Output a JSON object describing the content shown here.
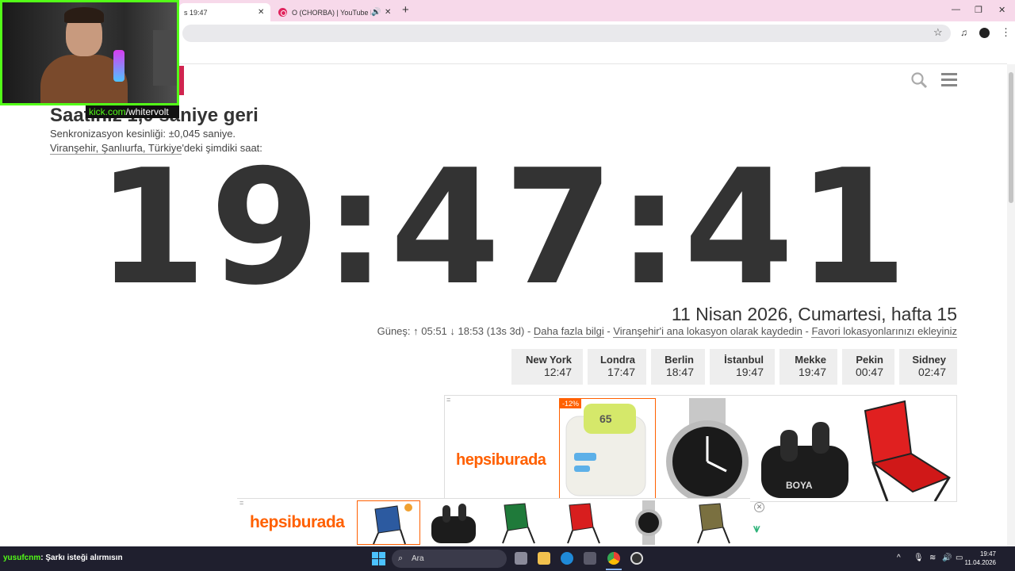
{
  "browser": {
    "tab1_title": "s 19:47",
    "tab2_title": "O (CHORBA) | YouTube Mu",
    "new_tab": "+",
    "close": "✕"
  },
  "overlay": {
    "kick_prefix": "kick.com",
    "kick_channel": "/whitervolt"
  },
  "page": {
    "sync_title": "Saatiniz 1,0 saniye geri",
    "sync_precision": "Senkronizasyon kesinliği: ±0,045 saniye.",
    "location_link": "Viranşehir, Şanlıurfa, Türkiye",
    "location_suffix": "'deki şimdiki saat:",
    "clock": "19:47:41",
    "date": "11 Nisan 2026, Cumartesi, hafta 15",
    "sun": "Güneş: ↑ 05:51 ↓ 18:53 (13s 3d) - ",
    "more_info": "Daha fazla bilgi",
    "sep": " - ",
    "save_location": "Viranşehir'i ana lokasyon olarak kaydedin",
    "favorites": "Favori lokasyonlarınızı ekleyiniz"
  },
  "cities": [
    {
      "name": "New York",
      "time": "12:47"
    },
    {
      "name": "Londra",
      "time": "17:47"
    },
    {
      "name": "Berlin",
      "time": "18:47"
    },
    {
      "name": "İstanbul",
      "time": "19:47"
    },
    {
      "name": "Mekke",
      "time": "19:47"
    },
    {
      "name": "Pekin",
      "time": "00:47"
    },
    {
      "name": "Sidney",
      "time": "02:47"
    }
  ],
  "ad": {
    "brand": "hepsiburada",
    "discount": "-12%",
    "product_badge": "65",
    "product_brand": "BOYA",
    "close_icon": "✕",
    "corner_mark": "="
  },
  "taskbar": {
    "chat_user": "yusufcnm",
    "chat_message": ": Şarkı isteği alırmısın",
    "search_placeholder": "Ara",
    "time": "19:47",
    "date": "11.04.2026"
  },
  "colors": {
    "tab_strip": "#f7d9ea",
    "kick_green": "#53fc18",
    "brand_orange": "#ff6000",
    "site_accent": "#d0254f"
  }
}
